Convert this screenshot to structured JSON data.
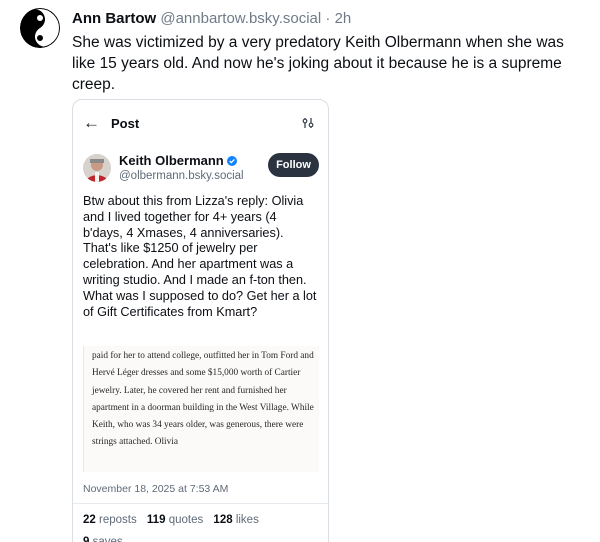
{
  "post": {
    "author_name": "Ann Bartow",
    "author_handle": "@annbartow.bsky.social",
    "separator": "·",
    "time": "2h",
    "text": "She was victimized by a very predatory Keith Olbermann when she was like 15 years old. And now he's joking about it because he is a supreme creep.",
    "avatar_icon": "yin-yang-icon"
  },
  "embed": {
    "title": "Post",
    "back_icon": "arrow-left-icon",
    "filter_icon": "sliders-icon",
    "author_name": "Keith Olbermann",
    "author_handle": "@olbermann.bsky.social",
    "verified_color": "#1083fe",
    "follow_label": "Follow",
    "text": "Btw about this from Lizza's reply: Olivia and I lived together for 4+ years (4 b'days, 4 Xmases, 4 anniversaries). That's like $1250 of jewelry per celebration. And her apartment was a writing studio. And I made an f-ton then. What was I supposed to do? Get her a lot of Gift Certificates from Kmart?",
    "clipping_text": "paid for her to attend college, outfitted her in Tom Ford and Hervé Léger dresses and some $15,000 worth of Cartier jewelry. Later, he covered her rent and furnished her apartment in a doorman building in the West Village. While Keith, who was 34 years older, was generous, there were strings attached. Olivia",
    "date": "November 18, 2025 at 7:53 AM",
    "stats": {
      "reposts_count": "22",
      "reposts_label": "reposts",
      "quotes_count": "119",
      "quotes_label": "quotes",
      "likes_count": "128",
      "likes_label": "likes"
    },
    "more_count": "9",
    "more_label": "saves"
  }
}
